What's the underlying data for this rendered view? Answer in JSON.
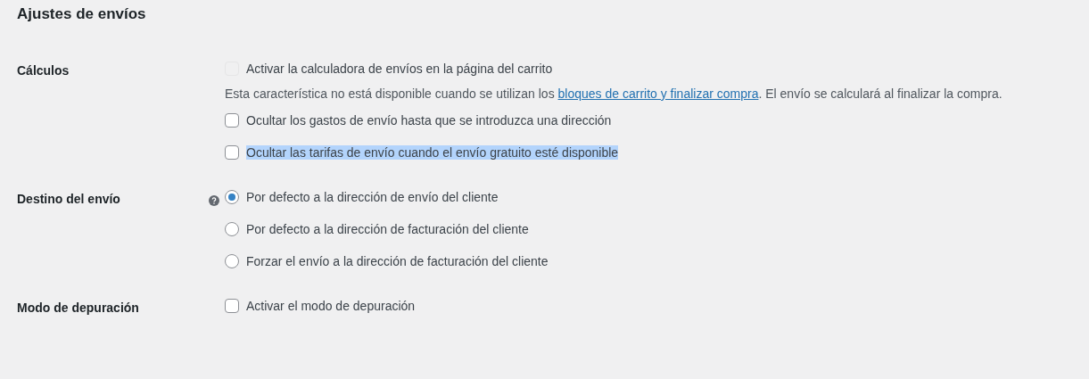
{
  "title": "Ajustes de envíos",
  "sections": [
    {
      "label": "Cálculos",
      "help": false,
      "items": [
        {
          "kind": "checkbox",
          "label": "Activar la calculadora de envíos en la página del carrito",
          "checked": false,
          "disabled": true,
          "highlighted": false
        },
        {
          "kind": "note",
          "text": "Esta característica no está disponible cuando se utilizan los",
          "link": "bloques de carrito y finalizar compra",
          "text_after": ". El envío se calculará al finalizar la compra."
        },
        {
          "kind": "checkbox",
          "label": "Ocultar los gastos de envío hasta que se introduzca una dirección",
          "checked": false,
          "disabled": false,
          "highlighted": false
        },
        {
          "kind": "checkbox",
          "label": "Ocultar las tarifas de envío cuando el envío gratuito esté disponible",
          "checked": false,
          "disabled": false,
          "highlighted": true
        }
      ]
    },
    {
      "label": "Destino del envío",
      "help": true,
      "items": [
        {
          "kind": "radio",
          "label": "Por defecto a la dirección de envío del cliente",
          "selected": true
        },
        {
          "kind": "radio",
          "label": "Por defecto a la dirección de facturación del cliente",
          "selected": false
        },
        {
          "kind": "radio",
          "label": "Forzar el envío a la dirección de facturación del cliente",
          "selected": false
        }
      ]
    },
    {
      "label": "Modo de depuración",
      "help": false,
      "items": [
        {
          "kind": "checkbox",
          "label": "Activar el modo de depuración",
          "checked": false,
          "disabled": false,
          "highlighted": false
        }
      ]
    }
  ]
}
